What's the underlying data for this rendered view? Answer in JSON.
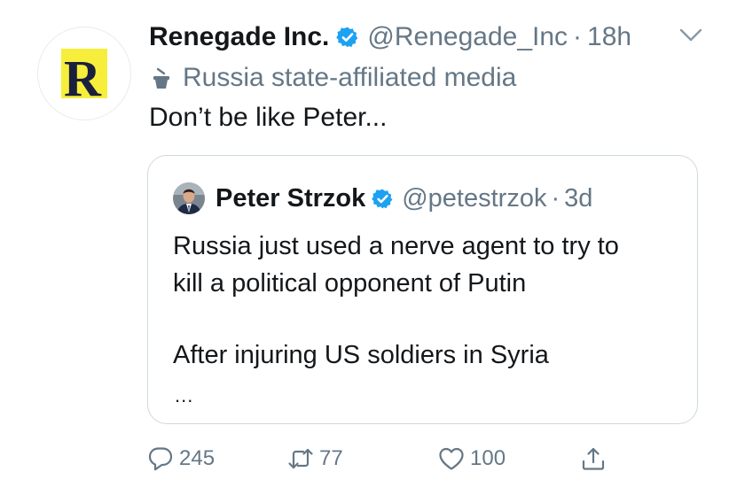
{
  "tweet": {
    "author": {
      "display_name": "Renegade Inc.",
      "handle": "@Renegade_Inc",
      "avatar_letter": "R",
      "verified": true
    },
    "separator": "·",
    "time": "18h",
    "label": "Russia state-affiliated media",
    "text": "Don’t be like Peter..."
  },
  "quoted_tweet": {
    "author": {
      "display_name": "Peter Strzok",
      "handle": "@petestrzok",
      "verified": true
    },
    "separator": "·",
    "time": "3d",
    "lines": [
      "Russia just used a nerve agent to try to",
      "kill a political opponent of Putin",
      "After injuring US soldiers in Syria"
    ],
    "ellipsis": "..."
  },
  "actions": {
    "reply_count": "245",
    "retweet_count": "77",
    "like_count": "100"
  },
  "icons": {
    "verified": "verified-badge-icon",
    "label": "podium-icon",
    "menu": "chevron-down-icon",
    "reply": "speech-bubble-icon",
    "retweet": "retweet-arrows-icon",
    "like": "heart-icon",
    "share": "share-upload-icon"
  },
  "colors": {
    "brand_blue": "#1da1f2",
    "secondary_text": "#657786",
    "primary_text": "#14171a",
    "logo_yellow": "#f6ee3a",
    "logo_navy": "#1a1f3d",
    "card_border": "#cfd9de"
  }
}
